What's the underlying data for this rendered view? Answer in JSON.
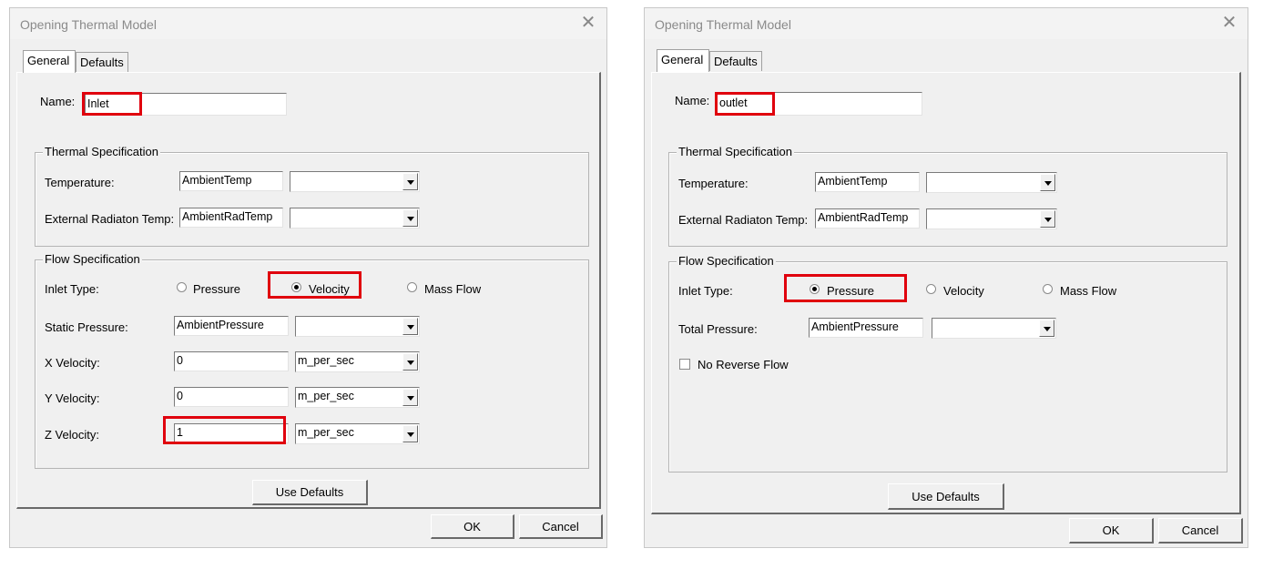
{
  "left": {
    "title": "Opening Thermal Model",
    "tabs": [
      "General",
      "Defaults"
    ],
    "name_label": "Name:",
    "name_value": "Inlet",
    "thermal": {
      "title": "Thermal Specification",
      "temperature_label": "Temperature:",
      "temperature_value": "AmbientTemp",
      "ext_rad_label": "External Radiaton Temp:",
      "ext_rad_value": "AmbientRadTemp"
    },
    "flow": {
      "title": "Flow Specification",
      "inlet_type_label": "Inlet Type:",
      "radio_pressure": "Pressure",
      "radio_velocity": "Velocity",
      "radio_massflow": "Mass Flow",
      "selected": "Velocity",
      "static_pressure_label": "Static Pressure:",
      "static_pressure_value": "AmbientPressure",
      "xvel_label": "X Velocity:",
      "xvel_value": "0",
      "xvel_unit": "m_per_sec",
      "yvel_label": "Y Velocity:",
      "yvel_value": "0",
      "yvel_unit": "m_per_sec",
      "zvel_label": "Z Velocity:",
      "zvel_value": "1",
      "zvel_unit": "m_per_sec"
    },
    "use_defaults": "Use Defaults",
    "ok": "OK",
    "cancel": "Cancel"
  },
  "right": {
    "title": "Opening Thermal Model",
    "tabs": [
      "General",
      "Defaults"
    ],
    "name_label": "Name:",
    "name_value": "outlet",
    "thermal": {
      "title": "Thermal Specification",
      "temperature_label": "Temperature:",
      "temperature_value": "AmbientTemp",
      "ext_rad_label": "External Radiaton Temp:",
      "ext_rad_value": "AmbientRadTemp"
    },
    "flow": {
      "title": "Flow Specification",
      "inlet_type_label": "Inlet Type:",
      "radio_pressure": "Pressure",
      "radio_velocity": "Velocity",
      "radio_massflow": "Mass Flow",
      "selected": "Pressure",
      "total_pressure_label": "Total Pressure:",
      "total_pressure_value": "AmbientPressure",
      "no_reverse_label": "No Reverse Flow"
    },
    "use_defaults": "Use Defaults",
    "ok": "OK",
    "cancel": "Cancel"
  },
  "colors": {
    "highlight": "#e0000d",
    "dialog_bg": "#f0f0f0"
  },
  "icons": {
    "close": "close-icon",
    "dropdown": "chevron-down-icon"
  }
}
